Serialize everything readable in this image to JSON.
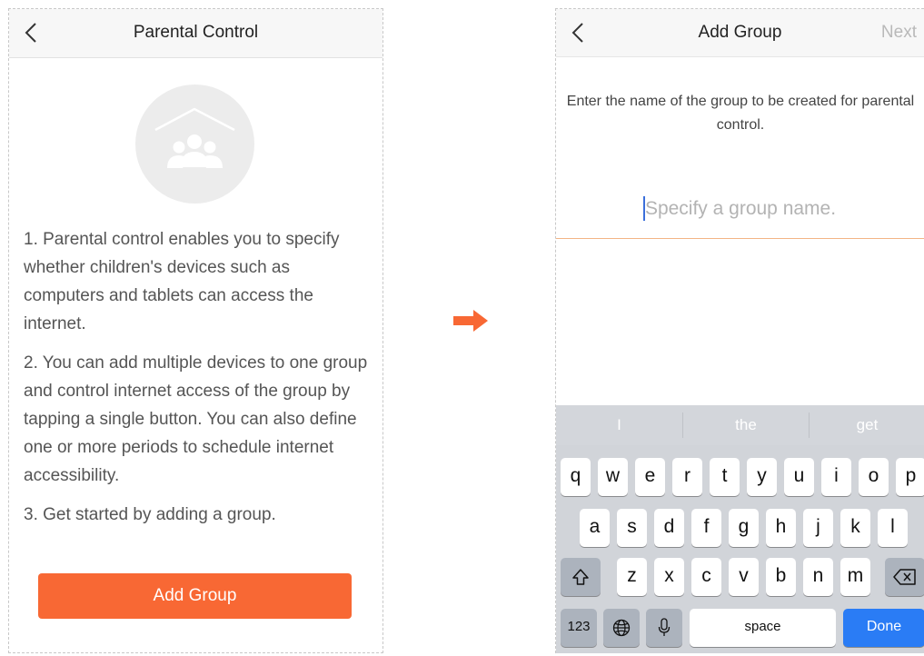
{
  "screen1": {
    "title": "Parental Control",
    "paragraphs": [
      "1. Parental control enables you to specify whether children's devices such as computers and tablets can access the internet.",
      "2. You can add multiple devices to one group and control internet access of the group by tapping a single button. You can also define one or more periods to schedule internet accessibility.",
      "3. Get started by adding a group."
    ],
    "add_group_label": "Add Group",
    "accent": "#f86834"
  },
  "screen2": {
    "title": "Add Group",
    "next_label": "Next",
    "instruction": "Enter the name of the group to be created for parental control.",
    "group_name": {
      "value": "",
      "placeholder": "Specify a group name."
    },
    "keyboard": {
      "suggestions": [
        "I",
        "the",
        "get"
      ],
      "row1": [
        "q",
        "w",
        "e",
        "r",
        "t",
        "y",
        "u",
        "i",
        "o",
        "p"
      ],
      "row2": [
        "a",
        "s",
        "d",
        "f",
        "g",
        "h",
        "j",
        "k",
        "l"
      ],
      "row3": [
        "z",
        "x",
        "c",
        "v",
        "b",
        "n",
        "m"
      ],
      "numbers_label": "123",
      "space_label": "space",
      "done_label": "Done"
    },
    "accent": "#2a7cf5"
  }
}
